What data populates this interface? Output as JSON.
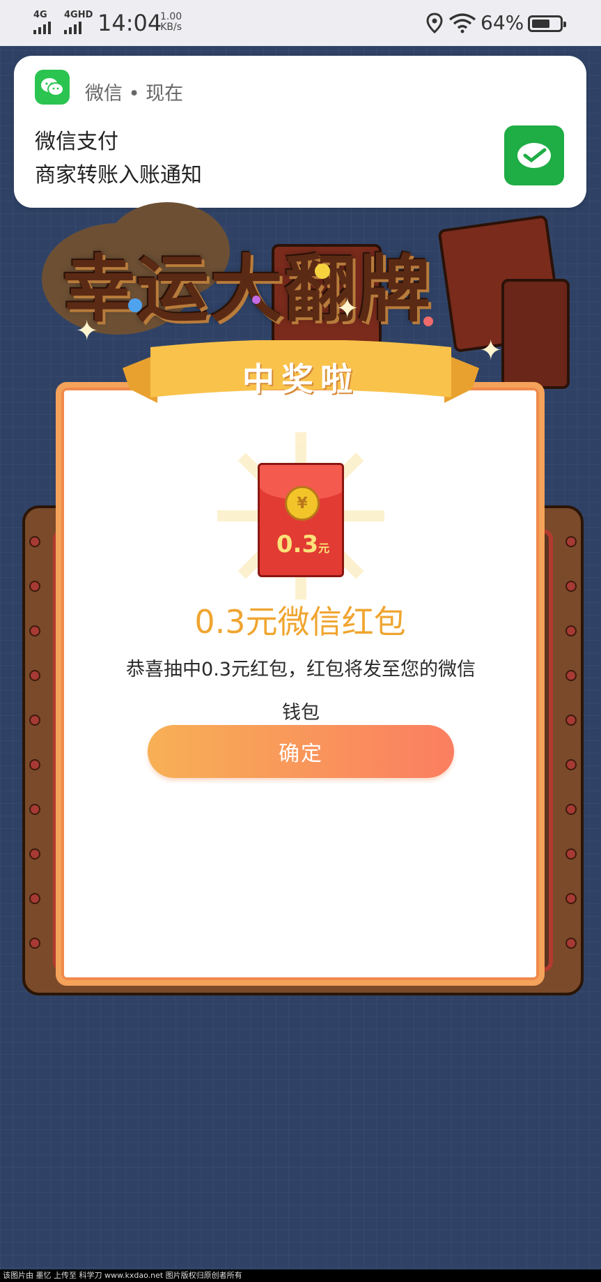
{
  "status_bar": {
    "net1": "4G",
    "net2": "4GHD",
    "time": "14:04",
    "speed_value": "1.00",
    "speed_unit": "KB/s",
    "battery_pct": "64%",
    "battery_level": 0.64
  },
  "notification": {
    "app_name": "微信",
    "time": "现在",
    "title": "微信支付",
    "body": "商家转账入账通知"
  },
  "game": {
    "banner": "幸运大翻牌",
    "ribbon": "中奖啦",
    "packet_amount": "0.3",
    "packet_unit": "元",
    "coin_symbol": "¥",
    "prize_title": "0.3元微信红包",
    "prize_desc": "恭喜抽中0.3元红包，红包将发至您的微信钱包",
    "confirm_label": "确定"
  },
  "footer": {
    "text": "该图片由 墨忆 上传至 科学刀 www.kxdao.net 图片版权归原创者所有"
  },
  "colors": {
    "background": "#2f4266",
    "wechat_green": "#2bc451",
    "prize_orange": "#f0a530",
    "button_start": "#f7b055",
    "button_end": "#fb7e61"
  }
}
